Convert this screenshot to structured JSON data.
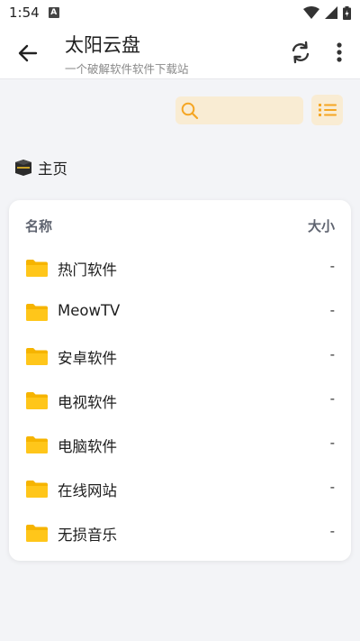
{
  "status": {
    "time": "1:54",
    "notif_letter": "A"
  },
  "appbar": {
    "title": "太阳云盘",
    "subtitle": "一个破解软件软件下载站"
  },
  "search": {
    "placeholder": ""
  },
  "breadcrumb": {
    "label": "主页"
  },
  "table": {
    "col_name": "名称",
    "col_size": "大小",
    "rows": [
      {
        "name": "热门软件",
        "size": "-"
      },
      {
        "name": "MeowTV",
        "size": "-"
      },
      {
        "name": "安卓软件",
        "size": "-"
      },
      {
        "name": "电视软件",
        "size": "-"
      },
      {
        "name": "电脑软件",
        "size": "-"
      },
      {
        "name": "在线网站",
        "size": "-"
      },
      {
        "name": "无损音乐",
        "size": "-"
      }
    ]
  },
  "colors": {
    "accent": "#f5a623",
    "folder": "#f6b400",
    "accent_bg": "#f9ecd3"
  }
}
